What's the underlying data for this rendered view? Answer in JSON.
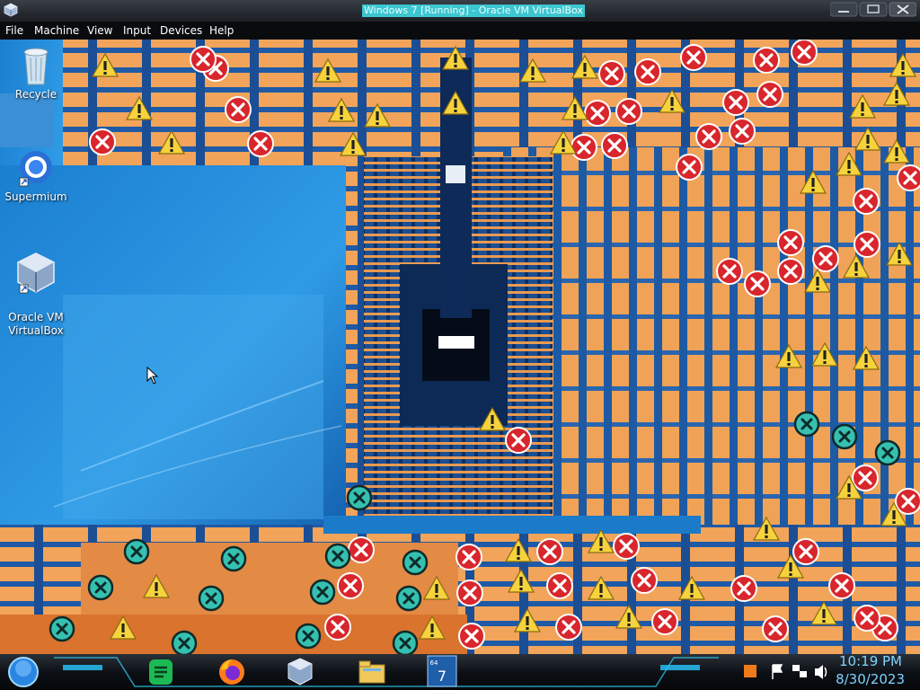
{
  "window": {
    "title": "Windows 7 [Running] - Oracle VM VirtualBox",
    "app_icon": "virtualbox-icon"
  },
  "menubar": {
    "items": [
      "File",
      "Machine",
      "View",
      "Input",
      "Devices",
      "Help"
    ]
  },
  "desktop": {
    "icons": [
      {
        "label": "Recycle",
        "icon": "recycle-bin-icon"
      },
      {
        "label": "Supermium",
        "icon": "supermium-browser-icon"
      },
      {
        "label": "Oracle VM\nVirtualBox",
        "icon": "virtualbox-icon"
      }
    ],
    "overlay_icons": [
      "error-icon",
      "warning-icon"
    ]
  },
  "taskbar": {
    "start_icon": "start-orb-icon",
    "pinned": [
      "notes-app-icon",
      "firefox-icon",
      "virtualbox-icon",
      "file-explorer-icon",
      "windows7-vm-icon"
    ],
    "tray": [
      "tray-app-icon",
      "action-center-flag-icon",
      "network-icon",
      "volume-icon"
    ],
    "clock": {
      "time": "10:19 PM",
      "date": "8/30/2023"
    }
  },
  "colors": {
    "title_highlight": "#3cc6d0",
    "desktop_blue": "#1e5fa8",
    "glitch_orange": "#f1a45a",
    "error_red": "#d8262c",
    "warning_yellow": "#f6d33c",
    "clock_cyan": "#7fd3ff"
  }
}
